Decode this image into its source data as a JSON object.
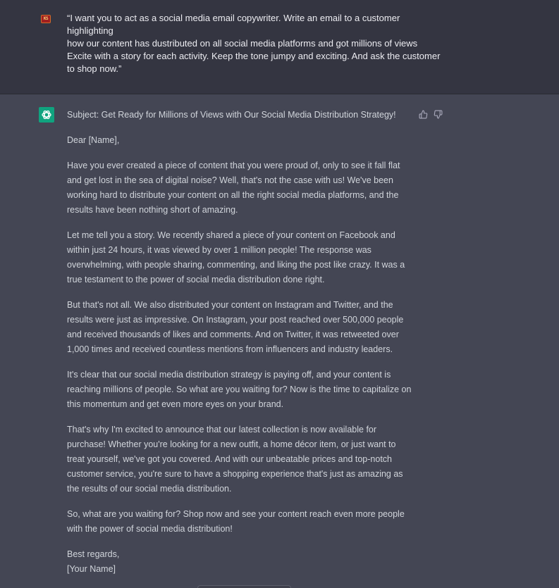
{
  "user": {
    "avatar_text": "KS",
    "prompt_lines": [
      "“I want you to act as a  social media email copywriter. Write an email to a customer",
      "highlighting",
      "how our content has dustributed on all social media platforms and got millions of views",
      "Excite with a story for each activity. Keep the tone jumpy and exciting. And ask the customer",
      "to shop now.”"
    ]
  },
  "assistant": {
    "subject": "Subject: Get Ready for Millions of Views with Our Social Media Distribution Strategy!",
    "greeting": "Dear [Name],",
    "paragraphs": [
      "Have you ever created a piece of content that you were proud of, only to see it fall flat and get lost in the sea of digital noise? Well, that's not the case with us! We've been working hard to distribute your content on all the right social media platforms, and the results have been nothing short of amazing.",
      "Let me tell you a story. We recently shared a piece of your content on Facebook and within just 24 hours, it was viewed by over 1 million people! The response was overwhelming, with people sharing, commenting, and liking the post like crazy. It was a true testament to the power of social media distribution done right.",
      "But that's not all. We also distributed your content on Instagram and Twitter, and the results were just as impressive. On Instagram, your post reached over 500,000 people and received thousands of likes and comments. And on Twitter, it was retweeted over 1,000 times and received countless mentions from influencers and industry leaders.",
      "It's clear that our social media distribution strategy is paying off, and your content is reaching millions of people. So what are you waiting for? Now is the time to capitalize on this momentum and get even more eyes on your brand.",
      "That's why I'm excited to announce that our latest collection is now available for purchase! Whether you're looking for a new outfit, a home décor item, or just want to treat yourself, we've got you covered. And with our unbeatable prices and top-notch customer service, you're sure to have a shopping experience that's just as amazing as the results of our social media distribution.",
      "So, what are you waiting for? Shop now and see your content reach even more people with the power of social media distribution!"
    ],
    "signoff": "Best regards,",
    "signature": "[Your Name]"
  },
  "icons": {
    "user_avatar": "user-avatar-icon",
    "assistant_avatar": "openai-logo-icon",
    "like": "thumbs-up-icon",
    "dislike": "thumbs-down-icon"
  },
  "colors": {
    "user_bg": "#343541",
    "assistant_bg": "#444654",
    "assistant_avatar_bg": "#10a37f",
    "text": "#d1d5db"
  }
}
